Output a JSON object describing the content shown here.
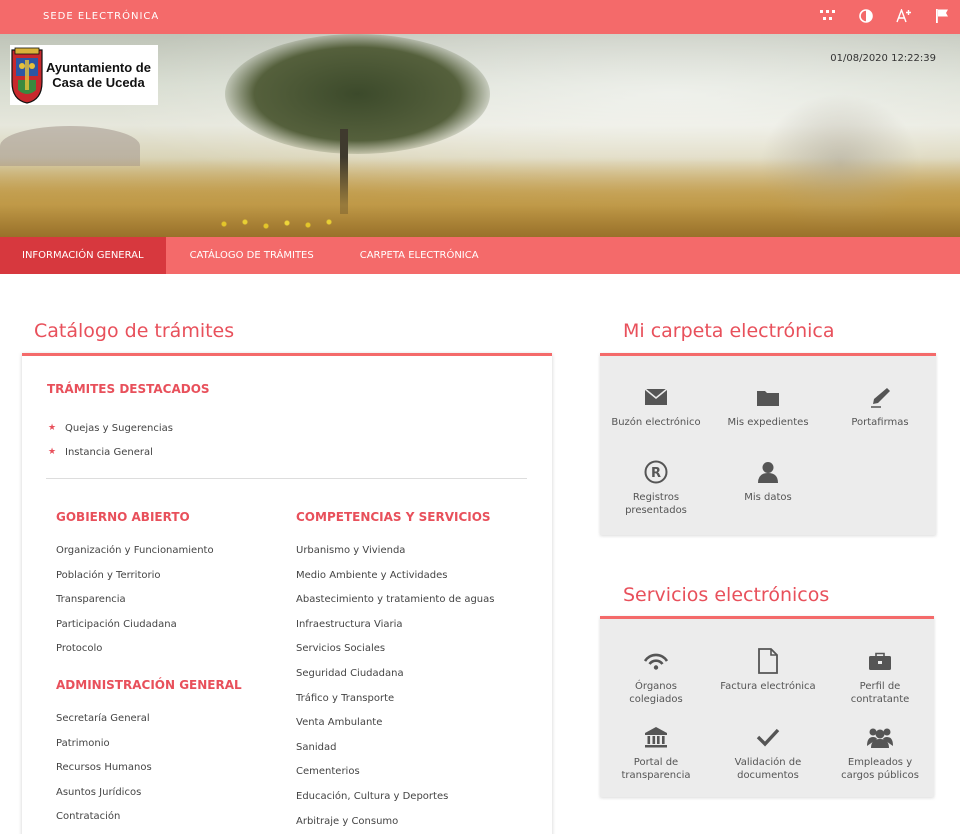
{
  "topbar": {
    "brand": "SEDE ELECTRÓNICA",
    "tools": [
      "sitemap-icon",
      "contrast-icon",
      "font-size-icon",
      "flag-icon"
    ]
  },
  "header": {
    "logo_text_line1": "Ayuntamiento de",
    "logo_text_line2": "Casa de Uceda",
    "datetime": "01/08/2020 12:22:39"
  },
  "nav": {
    "items": [
      {
        "label": "INFORMACIÓN GENERAL",
        "active": true
      },
      {
        "label": "CATÁLOGO DE TRÁMITES",
        "active": false
      },
      {
        "label": "CARPETA ELECTRÓNICA",
        "active": false
      }
    ]
  },
  "catalog": {
    "title": "Catálogo de trámites",
    "featured_heading": "TRÁMITES DESTACADOS",
    "featured": [
      "Quejas y Sugerencias",
      "Instancia General"
    ],
    "gobierno_heading": "GOBIERNO ABIERTO",
    "gobierno": [
      "Organización y Funcionamiento",
      "Población y Territorio",
      "Transparencia",
      "Participación Ciudadana",
      "Protocolo"
    ],
    "administracion_heading": "ADMINISTRACIÓN GENERAL",
    "administracion": [
      "Secretaría General",
      "Patrimonio",
      "Recursos Humanos",
      "Asuntos Jurídicos",
      "Contratación"
    ],
    "competencias_heading": "COMPETENCIAS Y SERVICIOS",
    "competencias": [
      "Urbanismo y Vivienda",
      "Medio Ambiente y Actividades",
      "Abastecimiento y tratamiento de aguas",
      "Infraestructura Viaria",
      "Servicios Sociales",
      "Seguridad Ciudadana",
      "Tráfico y Transporte",
      "Venta Ambulante",
      "Sanidad",
      "Cementerios",
      "Educación, Cultura y Deportes",
      "Arbitraje y Consumo"
    ]
  },
  "carpeta": {
    "title": "Mi carpeta electrónica",
    "tiles": [
      {
        "label": "Buzón electrónico",
        "icon": "envelope-icon"
      },
      {
        "label": "Mis expedientes",
        "icon": "folder-icon"
      },
      {
        "label": "Portafirmas",
        "icon": "pen-icon"
      },
      {
        "label": "Registros presentados",
        "icon": "registered-icon"
      },
      {
        "label": "Mis datos",
        "icon": "user-icon"
      }
    ]
  },
  "servicios": {
    "title": "Servicios electrónicos",
    "tiles": [
      {
        "label": "Órganos colegiados",
        "icon": "signal-icon"
      },
      {
        "label": "Factura electrónica",
        "icon": "document-icon"
      },
      {
        "label": "Perfil de contratante",
        "icon": "briefcase-icon"
      },
      {
        "label": "Portal de transparencia",
        "icon": "institution-icon"
      },
      {
        "label": "Validación de documentos",
        "icon": "check-icon"
      },
      {
        "label": "Empleados y cargos públicos",
        "icon": "group-icon"
      }
    ]
  },
  "colors": {
    "accent": "#f46a6a",
    "accent_dark": "#d7383e",
    "heading": "#e8505b",
    "panel_bg": "#ececec",
    "icon": "#555555"
  }
}
